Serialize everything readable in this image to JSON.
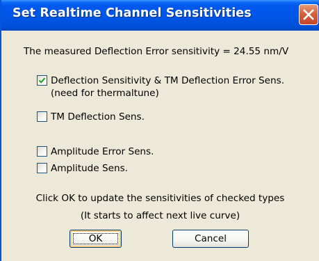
{
  "window": {
    "title": "Set Realtime Channel Sensitivities",
    "close_glyph": "close-icon"
  },
  "measured_text": "The measured Deflection Error sensitivity = 24.55 nm/V",
  "options": [
    {
      "label_line1": "Deflection Sensitivity & TM Deflection Error Sens.",
      "label_line2": "(need for thermaltune)",
      "checked": true
    },
    {
      "label_line1": "TM Deflection Sens.",
      "checked": false
    },
    {
      "label_line1": "Amplitude Error Sens.",
      "checked": false
    },
    {
      "label_line1": "Amplitude Sens.",
      "checked": false
    }
  ],
  "instructions": {
    "line1": "Click OK to update the sensitivities of checked types",
    "line2": "(It starts to affect next live curve)"
  },
  "buttons": {
    "ok_label": "OK",
    "cancel_label": "Cancel"
  },
  "colors": {
    "titlebar": "#0058ee",
    "client_bg": "#ece9d8",
    "close_button": "#d5613d",
    "checkmark": "#21a121"
  }
}
